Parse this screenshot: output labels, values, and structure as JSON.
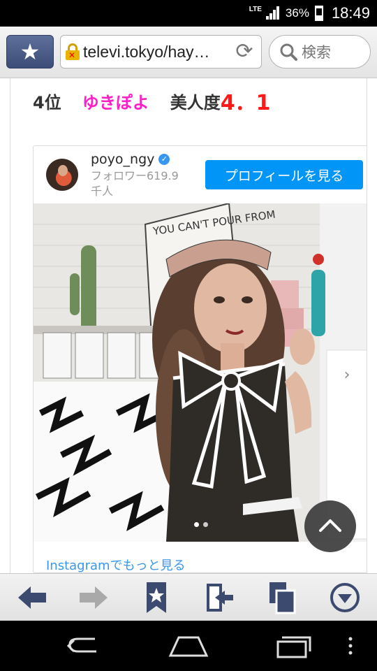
{
  "status_bar": {
    "network": "LTE",
    "battery": "36%",
    "time": "18:49"
  },
  "toolbar": {
    "url": "televi.tokyo/hay…",
    "search_label": "検索"
  },
  "article": {
    "rank": "4位",
    "name": "ゆきぽよ",
    "score_label": "美人度",
    "score": "4．1"
  },
  "instagram": {
    "username": "poyo_ngy",
    "followers": "フォロワー619.9千人",
    "profile_button": "プロフィールを見る",
    "photo_sign_text": "YOU CAN'T POUR FROM",
    "more_link": "Instagramでもっと見る",
    "carousel": {
      "total": 2,
      "current": 1
    }
  },
  "colors": {
    "rank_name": "#ff1fc8",
    "score": "#ff1a1a",
    "ig_blue": "#0095f6",
    "toolbar_star": "#3c4d77"
  },
  "icons": [
    "back-arrow-icon",
    "forward-arrow-icon",
    "bookmark-icon",
    "exit-door-icon",
    "tabs-icon",
    "menu-down-icon",
    "nav-back-icon",
    "nav-home-icon",
    "nav-recents-icon",
    "nav-overflow-icon"
  ]
}
